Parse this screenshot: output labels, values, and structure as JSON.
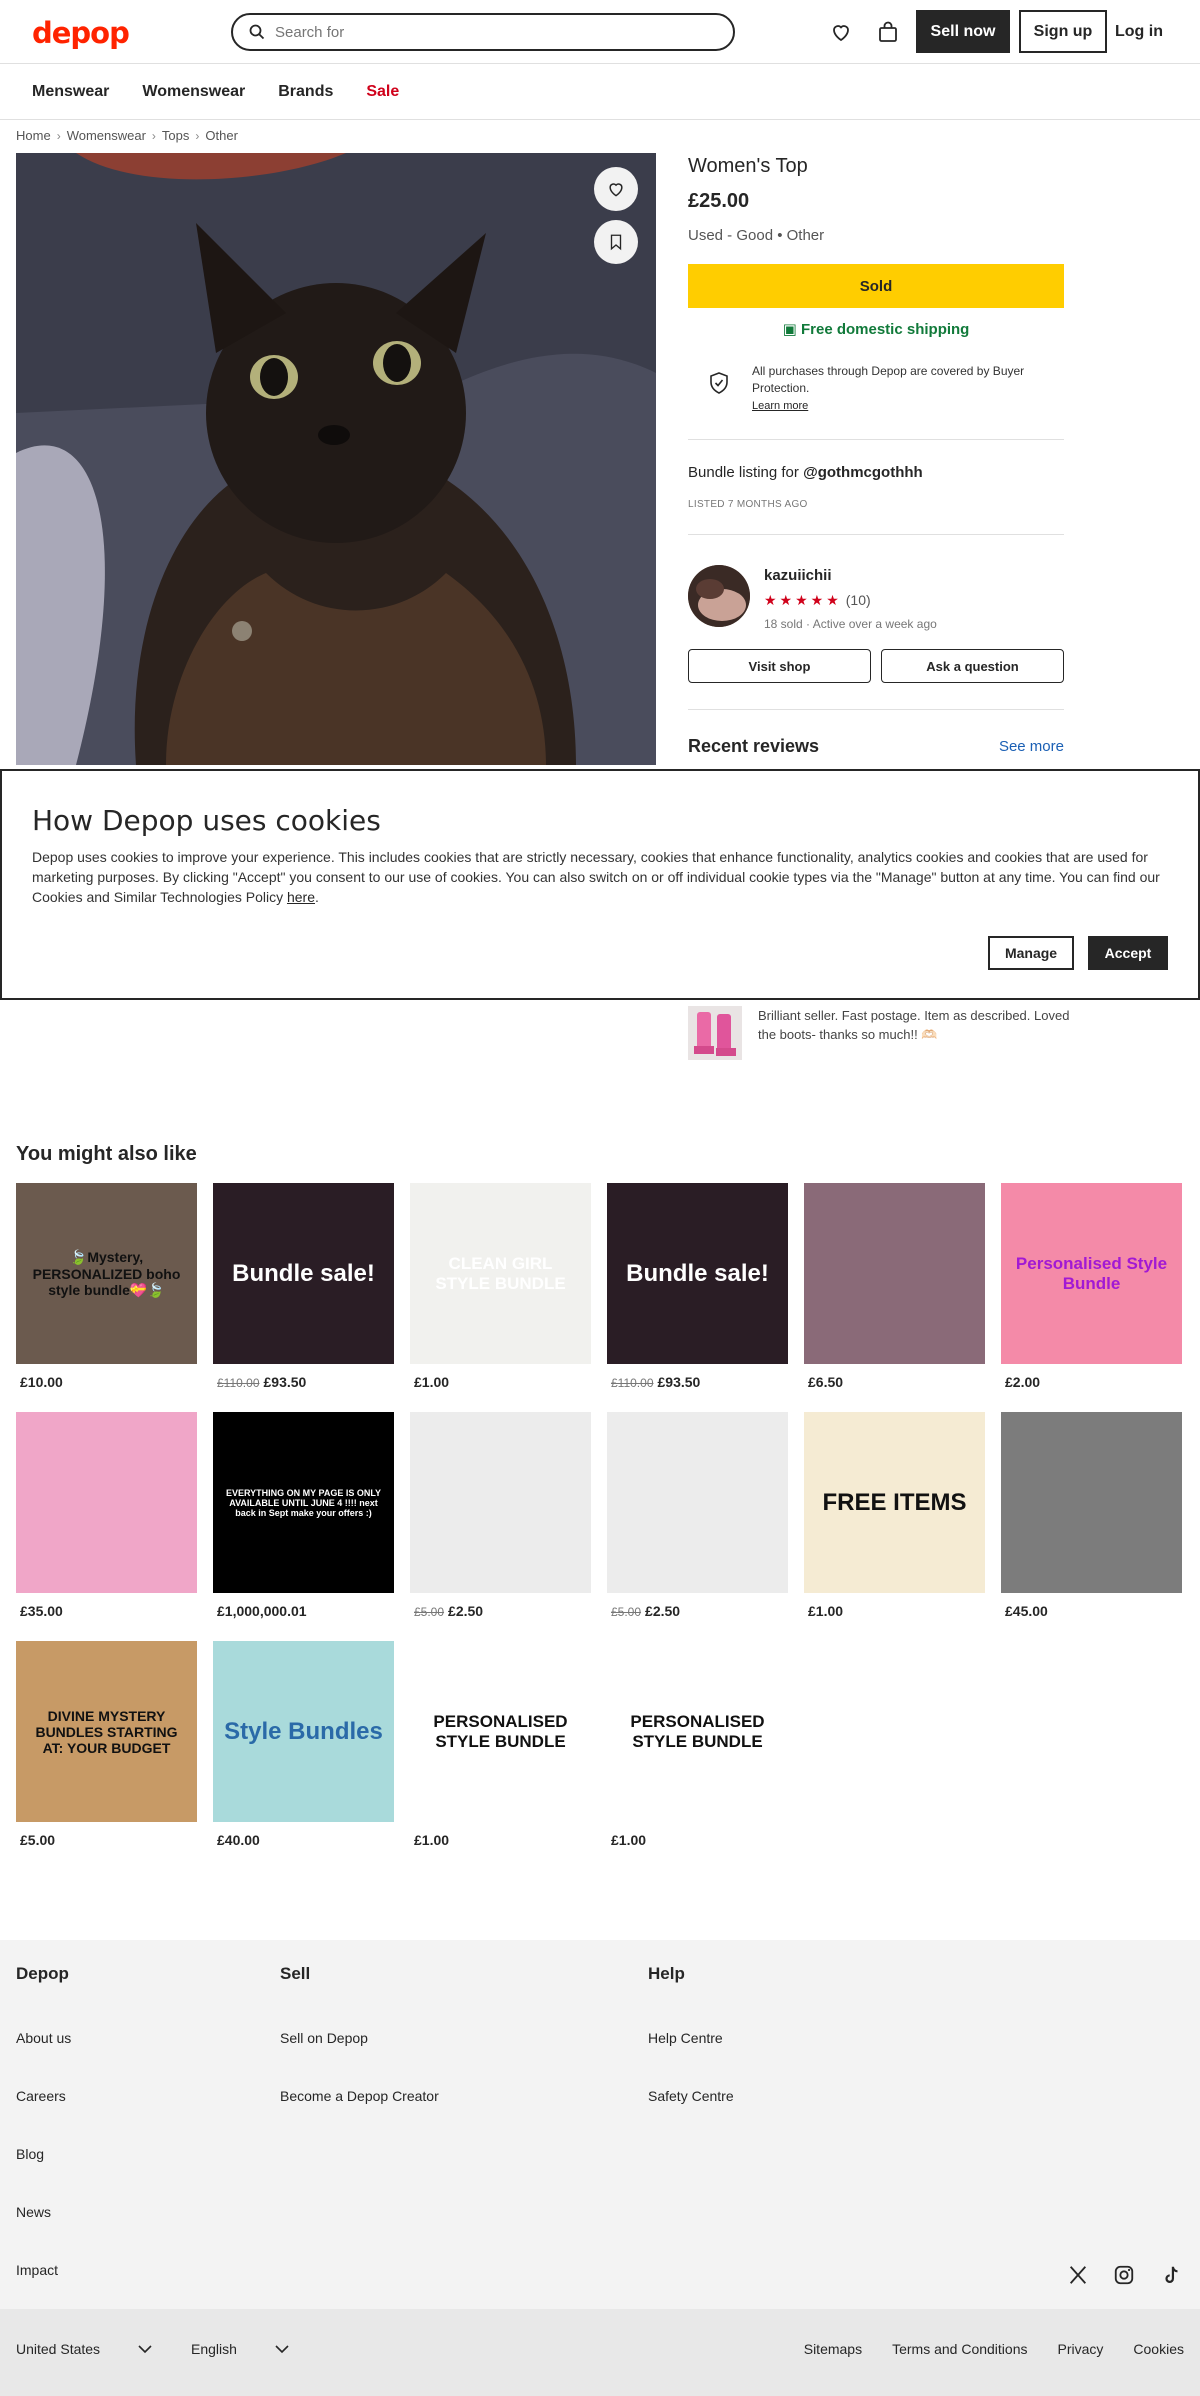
{
  "header": {
    "logo": "depop",
    "search_placeholder": "Search for",
    "sell_label": "Sell now",
    "signup_label": "Sign up",
    "login_label": "Log in"
  },
  "nav": {
    "items": [
      "Menswear",
      "Womenswear",
      "Brands",
      "Sale"
    ]
  },
  "breadcrumb": [
    "Home",
    "Womenswear",
    "Tops",
    "Other"
  ],
  "product": {
    "title": "Women's Top",
    "price": "£25.00",
    "condition": "Used - Good • Other",
    "sold_label": "Sold",
    "shipping": "Free domestic shipping",
    "protection": "All purchases through Depop are covered by Buyer Protection.",
    "learn_more": "Learn more",
    "bundle_prefix": "Bundle listing for ",
    "bundle_user": "@gothmcgothhh",
    "listed": "LISTED 7 MONTHS AGO"
  },
  "seller": {
    "username": "kazuiichii",
    "stars": "★★★★★",
    "rating_count": "(10)",
    "sold": "18 sold",
    "active": "Active over a week ago",
    "visit_label": "Visit shop",
    "ask_label": "Ask a question"
  },
  "reviews": {
    "heading": "Recent reviews",
    "see_more": "See more",
    "text": "Brilliant seller. Fast postage. Item as described. Loved the boots- thanks so much!! 🫶🏻"
  },
  "cookie": {
    "title": "How Depop uses cookies",
    "body": "Depop uses cookies to improve your experience. This includes cookies that are strictly necessary, cookies that enhance functionality, analytics cookies and cookies that are used for marketing purposes. By clicking \"Accept\" you consent to our use of cookies. You can also switch on or off individual cookie types via the \"Manage\" button at any time. You can find our Cookies and Similar Technologies Policy ",
    "link": "here",
    "manage_label": "Manage",
    "accept_label": "Accept"
  },
  "recommendations": {
    "heading": "You might also like",
    "items": [
      {
        "price": "£10.00",
        "old": "",
        "label": "🍃Mystery, PERSONALIZED boho style bundle💝🍃",
        "bg": "#6b5a4e",
        "fg": "#111"
      },
      {
        "price": "£93.50",
        "old": "£110.00",
        "label": "Bundle sale!",
        "bg": "#2a1d25",
        "fg": "#fff"
      },
      {
        "price": "£1.00",
        "old": "",
        "label": "CLEAN GIRL STYLE BUNDLE",
        "bg": "#f1f1ee",
        "fg": "#fff"
      },
      {
        "price": "£93.50",
        "old": "£110.00",
        "label": "Bundle sale!",
        "bg": "#2a1d25",
        "fg": "#fff"
      },
      {
        "price": "£6.50",
        "old": "",
        "label": "",
        "bg": "#8a6a78",
        "fg": "#fff"
      },
      {
        "price": "£2.00",
        "old": "",
        "label": "Personalised Style Bundle",
        "bg": "#f48aa8",
        "fg": "#a219d4"
      },
      {
        "price": "£35.00",
        "old": "",
        "label": "",
        "bg": "#f0a6c8",
        "fg": "#fff"
      },
      {
        "price": "£1,000,000.01",
        "old": "",
        "label": "EVERYTHING ON MY PAGE IS ONLY AVAILABLE UNTIL JUNE 4 !!!! next back in Sept make your offers :)",
        "bg": "#000",
        "fg": "#fff"
      },
      {
        "price": "£2.50",
        "old": "£5.00",
        "label": "",
        "bg": "#ececec",
        "fg": "#111"
      },
      {
        "price": "£2.50",
        "old": "£5.00",
        "label": "",
        "bg": "#ececec",
        "fg": "#111"
      },
      {
        "price": "£1.00",
        "old": "",
        "label": "FREE ITEMS",
        "bg": "#f5ebd3",
        "fg": "#111"
      },
      {
        "price": "£45.00",
        "old": "",
        "label": "",
        "bg": "#7c7c7c",
        "fg": "#fff"
      },
      {
        "price": "£5.00",
        "old": "",
        "label": "DIVINE MYSTERY BUNDLES STARTING AT: YOUR BUDGET",
        "bg": "#c79a66",
        "fg": "#111"
      },
      {
        "price": "£40.00",
        "old": "",
        "label": "Style Bundles",
        "bg": "#a9dadb",
        "fg": "#2a6aa8"
      },
      {
        "price": "£1.00",
        "old": "",
        "label": "PERSONALISED STYLE BUNDLE",
        "bg": "#fff",
        "fg": "#111"
      },
      {
        "price": "£1.00",
        "old": "",
        "label": "PERSONALISED STYLE BUNDLE",
        "bg": "#fff",
        "fg": "#111"
      }
    ]
  },
  "footer": {
    "col1": {
      "title": "Depop",
      "links": [
        "About us",
        "Careers",
        "Blog",
        "News",
        "Impact"
      ]
    },
    "col2": {
      "title": "Sell",
      "links": [
        "Sell on Depop",
        "Become a Depop Creator"
      ]
    },
    "col3": {
      "title": "Help",
      "links": [
        "Help Centre",
        "Safety Centre"
      ]
    },
    "country": "United States",
    "language": "English",
    "links": [
      "Sitemaps",
      "Terms and Conditions",
      "Privacy",
      "Cookies"
    ]
  },
  "colors": {
    "brand": "#ff2300",
    "sold": "#ffcd00",
    "sale": "#d0021b",
    "shipping": "#117a3a"
  }
}
